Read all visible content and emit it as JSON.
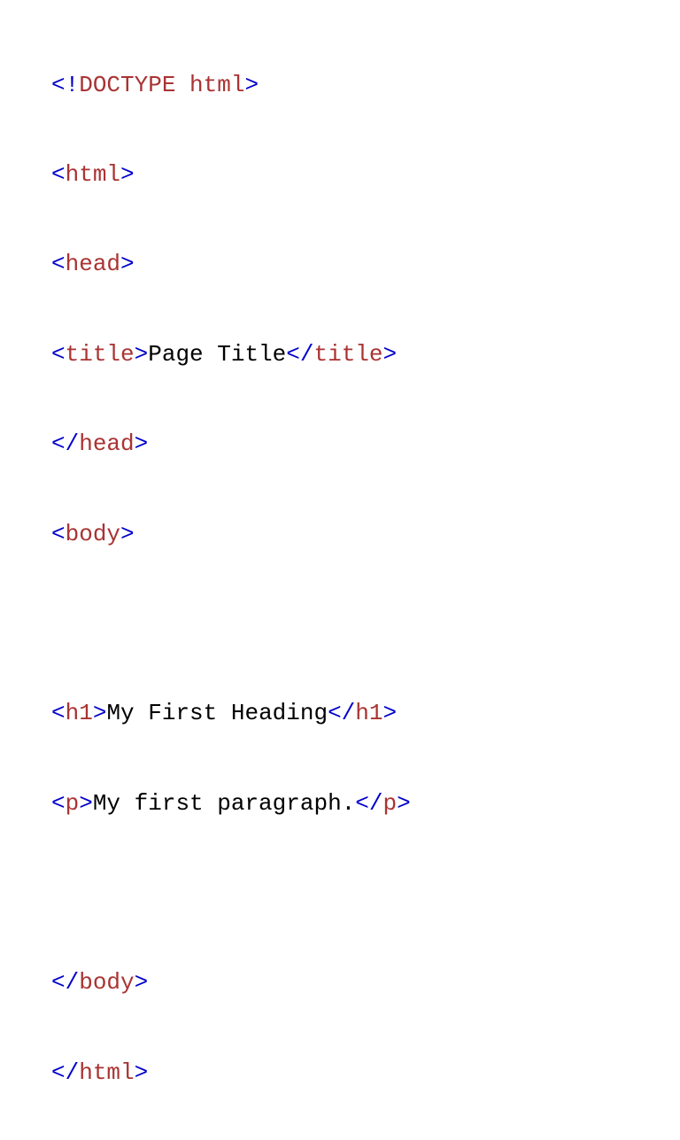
{
  "colors": {
    "bracket": "#0000cc",
    "tagname": "#aa3333",
    "text": "#000000"
  },
  "tokens": {
    "lt": "<",
    "gt": ">",
    "lt_bang": "<!",
    "lt_slash": "</",
    "doctype": "DOCTYPE",
    "space": " ",
    "html": "html",
    "head": "head",
    "title": "title",
    "body": "body",
    "h1": "h1",
    "p": "p"
  },
  "content": {
    "title_text": "Page Title",
    "heading_text": "My First Heading",
    "paragraph_text": "My first paragraph."
  }
}
